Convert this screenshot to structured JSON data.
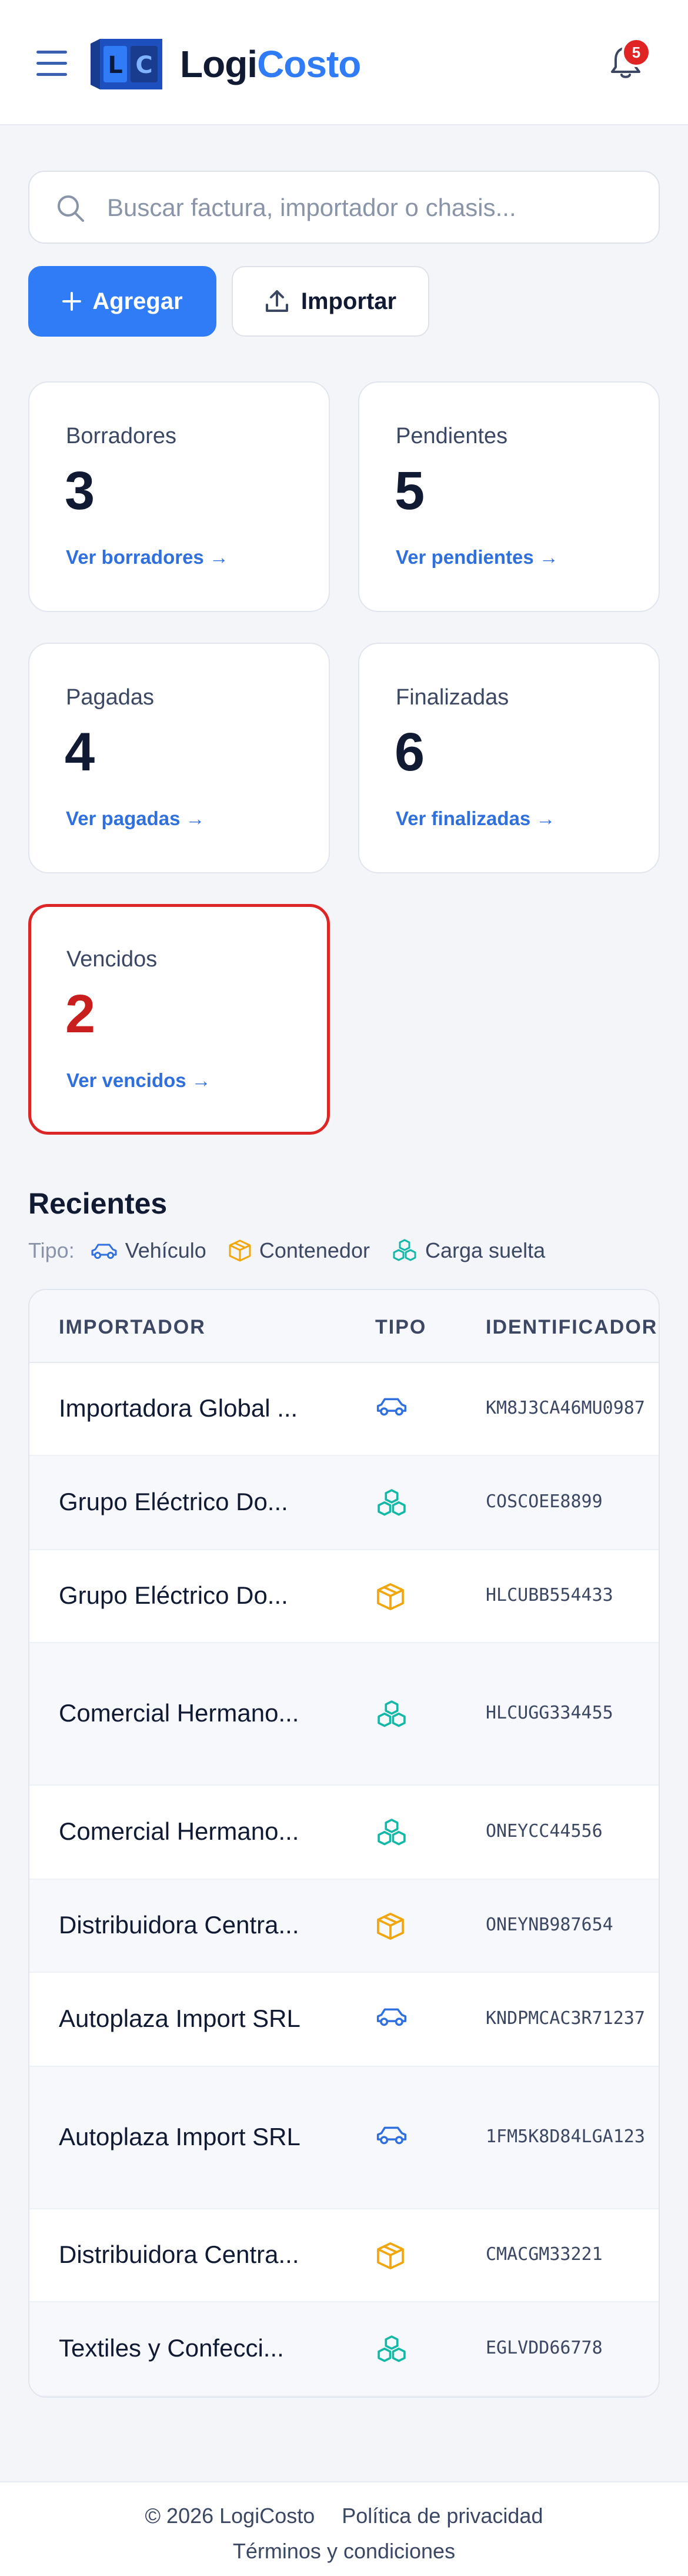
{
  "header": {
    "logo_mark_left": "L",
    "logo_mark_right": "C",
    "brand_part1": "Logi",
    "brand_part2": "Costo",
    "notifications_count": "5"
  },
  "search": {
    "placeholder": "Buscar factura, importador o chasis...",
    "value": ""
  },
  "actions": {
    "add_label": "Agregar",
    "import_label": "Importar"
  },
  "stats": [
    {
      "label": "Borradores",
      "count": "3",
      "link": "Ver borradores →"
    },
    {
      "label": "Pendientes",
      "count": "5",
      "link": "Ver pendientes →"
    },
    {
      "label": "Pagadas",
      "count": "4",
      "link": "Ver pagadas →"
    },
    {
      "label": "Finalizadas",
      "count": "6",
      "link": "Ver finalizadas →"
    },
    {
      "label": "Vencidos",
      "count": "2",
      "link": "Ver vencidos →"
    }
  ],
  "recent": {
    "title": "Recientes",
    "legend_prefix": "Tipo:",
    "legend": [
      {
        "label": "Vehículo",
        "icon": "car-icon",
        "color": "#2f6fde"
      },
      {
        "label": "Contenedor",
        "icon": "box-icon",
        "color": "#f2a60d"
      },
      {
        "label": "Carga suelta",
        "icon": "cubes-icon",
        "color": "#14b8a6"
      }
    ],
    "columns": [
      "IMPORTADOR",
      "TIPO",
      "IDENTIFICADOR"
    ],
    "rows": [
      {
        "importer": "Importadora Global ...",
        "type": "vehiculo",
        "id": "KM8J3CA46MU0987"
      },
      {
        "importer": "Grupo Eléctrico Do...",
        "type": "carga",
        "id": "COSCOEE8899"
      },
      {
        "importer": "Grupo Eléctrico Do...",
        "type": "contenedor",
        "id": "HLCUBB554433"
      },
      {
        "importer": "Comercial Hermano...",
        "type": "carga",
        "id": "HLCUGG334455"
      },
      {
        "importer": "Comercial Hermano...",
        "type": "carga",
        "id": "ONEYCC44556"
      },
      {
        "importer": "Distribuidora Centra...",
        "type": "contenedor",
        "id": "ONEYNB987654"
      },
      {
        "importer": "Autoplaza Import SRL",
        "type": "vehiculo",
        "id": "KNDPMCAC3R71237"
      },
      {
        "importer": "Autoplaza Import SRL",
        "type": "vehiculo",
        "id": "1FM5K8D84LGA123"
      },
      {
        "importer": "Distribuidora Centra...",
        "type": "contenedor",
        "id": "CMACGM33221"
      },
      {
        "importer": "Textiles y Confecci...",
        "type": "carga",
        "id": "EGLVDD66778"
      }
    ]
  },
  "footer": {
    "copyright": "© 2026 LogiCosto",
    "privacy": "Política de privacidad",
    "terms": "Términos y condiciones"
  }
}
